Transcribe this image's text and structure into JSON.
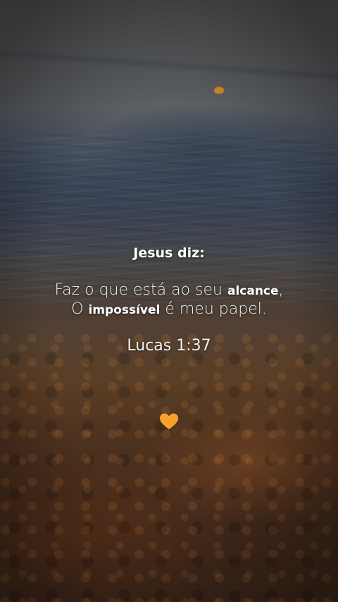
{
  "caption": {
    "heading": "Jesus diz:",
    "line1": {
      "pre": "Faz o que está ao seu ",
      "bold": "alcance",
      "post": ","
    },
    "line2": {
      "pre": "O ",
      "bold": "impossível",
      "post": " é meu papel."
    },
    "reference": "Lucas 1:37"
  },
  "heart": {
    "icon": "orange-heart-icon",
    "color": "#f7a22d"
  }
}
